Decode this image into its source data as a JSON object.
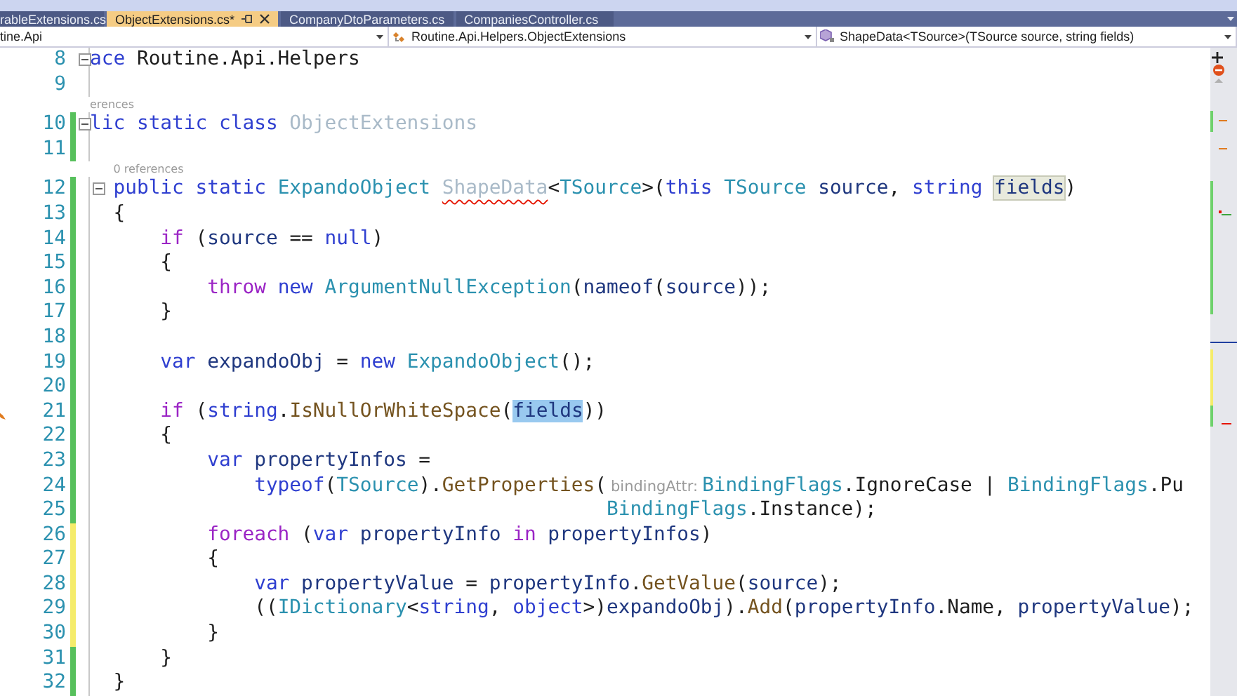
{
  "tabs": [
    {
      "label": "rableExtensions.cs",
      "selected": false
    },
    {
      "label": "ObjectExtensions.cs*",
      "selected": true
    },
    {
      "label": "CompanyDtoParameters.cs",
      "selected": false
    },
    {
      "label": "CompaniesController.cs",
      "selected": false
    }
  ],
  "navigation": [
    {
      "kind": "project",
      "text": "tine.Api"
    },
    {
      "kind": "class",
      "text": "Routine.Api.Helpers.ObjectExtensions"
    },
    {
      "kind": "method",
      "text": "ShapeData<TSource>(TSource source, string fields)"
    }
  ],
  "lines": [
    {
      "number": "8",
      "modified": false,
      "collapsible": true,
      "tokens": [
        {
          "kind": "keyword",
          "text": "ace"
        },
        {
          "kind": "plain",
          "text": " Routine.Api.Helpers"
        }
      ]
    },
    {
      "number": "9",
      "modified": false,
      "collapsible": false
    },
    {
      "codelens": "erences",
      "number": "10",
      "modified": true,
      "saved": true,
      "collapsible": true,
      "tokens": [
        {
          "kind": "keyword",
          "text": "lic static class "
        },
        {
          "kind": "faded",
          "text": "ObjectExtensions"
        }
      ]
    },
    {
      "number": "11",
      "modified": true,
      "saved": true,
      "collapsible": false
    },
    {
      "codelens": "0 references",
      "number": "12",
      "modified": true,
      "saved": true,
      "collapsible": true,
      "tokens": [
        {
          "kind": "keyword",
          "text": "  public static "
        },
        {
          "kind": "type",
          "text": "ExpandoObject "
        },
        {
          "kind": "error",
          "text": "ShapeData"
        },
        {
          "kind": "plain",
          "text": "<"
        },
        {
          "kind": "type",
          "text": "TSource"
        },
        {
          "kind": "plain",
          "text": ">("
        },
        {
          "kind": "keyword",
          "text": "this "
        },
        {
          "kind": "type",
          "text": "TSource "
        },
        {
          "kind": "variable",
          "text": "source"
        },
        {
          "kind": "plain",
          "text": ", "
        },
        {
          "kind": "keyword",
          "text": "string "
        },
        {
          "kind": "reference",
          "text": "fields"
        },
        {
          "kind": "plain",
          "text": ")"
        }
      ]
    },
    {
      "number": "13",
      "modified": true,
      "saved": true,
      "collapsible": false,
      "tokens": [
        {
          "kind": "plain",
          "text": "  {"
        }
      ]
    },
    {
      "number": "14",
      "modified": true,
      "saved": true,
      "collapsible": false,
      "tokens": [
        {
          "kind": "control",
          "text": "      if"
        },
        {
          "kind": "plain",
          "text": " ("
        },
        {
          "kind": "variable",
          "text": "source"
        },
        {
          "kind": "plain",
          "text": " == "
        },
        {
          "kind": "keyword",
          "text": "null"
        },
        {
          "kind": "plain",
          "text": ")"
        }
      ]
    },
    {
      "number": "15",
      "modified": true,
      "saved": true,
      "collapsible": false,
      "tokens": [
        {
          "kind": "plain",
          "text": "      {"
        }
      ]
    },
    {
      "number": "16",
      "modified": true,
      "saved": true,
      "collapsible": false,
      "tokens": [
        {
          "kind": "control",
          "text": "          throw "
        },
        {
          "kind": "keyword",
          "text": "new "
        },
        {
          "kind": "type",
          "text": "ArgumentNullException"
        },
        {
          "kind": "plain",
          "text": "("
        },
        {
          "kind": "variable",
          "text": "nameof"
        },
        {
          "kind": "plain",
          "text": "("
        },
        {
          "kind": "variable",
          "text": "source"
        },
        {
          "kind": "plain",
          "text": "));"
        }
      ]
    },
    {
      "number": "17",
      "modified": true,
      "saved": true,
      "collapsible": false,
      "tokens": [
        {
          "kind": "plain",
          "text": "      }"
        }
      ]
    },
    {
      "number": "18",
      "modified": true,
      "saved": true,
      "collapsible": false
    },
    {
      "number": "19",
      "modified": true,
      "saved": true,
      "collapsible": false,
      "tokens": [
        {
          "kind": "keyword",
          "text": "      var "
        },
        {
          "kind": "variable",
          "text": "expandoObj"
        },
        {
          "kind": "plain",
          "text": " = "
        },
        {
          "kind": "keyword",
          "text": "new "
        },
        {
          "kind": "type",
          "text": "ExpandoObject"
        },
        {
          "kind": "plain",
          "text": "();"
        }
      ]
    },
    {
      "number": "20",
      "modified": true,
      "saved": true,
      "collapsible": false
    },
    {
      "number": "21",
      "modified": true,
      "saved": true,
      "collapsible": false,
      "tokens": [
        {
          "kind": "control",
          "text": "      if"
        },
        {
          "kind": "plain",
          "text": " ("
        },
        {
          "kind": "keyword",
          "text": "string"
        },
        {
          "kind": "plain",
          "text": "."
        },
        {
          "kind": "method",
          "text": "IsNullOrWhiteSpace"
        },
        {
          "kind": "plain",
          "text": "("
        },
        {
          "kind": "selection",
          "text": "fields"
        },
        {
          "kind": "plain",
          "text": "))"
        }
      ]
    },
    {
      "number": "22",
      "modified": true,
      "saved": true,
      "collapsible": false,
      "tokens": [
        {
          "kind": "plain",
          "text": "      {"
        }
      ]
    },
    {
      "number": "23",
      "modified": true,
      "saved": true,
      "collapsible": false,
      "tokens": [
        {
          "kind": "keyword",
          "text": "          var "
        },
        {
          "kind": "variable",
          "text": "propertyInfos"
        },
        {
          "kind": "plain",
          "text": " ="
        }
      ]
    },
    {
      "number": "24",
      "modified": true,
      "saved": true,
      "collapsible": false,
      "tokens": [
        {
          "kind": "keyword",
          "text": "              typeof"
        },
        {
          "kind": "plain",
          "text": "("
        },
        {
          "kind": "type",
          "text": "TSource"
        },
        {
          "kind": "plain",
          "text": ")."
        },
        {
          "kind": "method",
          "text": "GetProperties"
        },
        {
          "kind": "plain",
          "text": "("
        },
        {
          "kind": "hint",
          "text": "bindingAttr:"
        },
        {
          "kind": "type",
          "text": "BindingFlags"
        },
        {
          "kind": "plain",
          "text": ".IgnoreCase | "
        },
        {
          "kind": "type",
          "text": "BindingFlags"
        },
        {
          "kind": "plain",
          "text": ".Pu"
        }
      ]
    },
    {
      "number": "25",
      "modified": true,
      "saved": true,
      "collapsible": false,
      "tokens": [
        {
          "kind": "type",
          "text": "                                            BindingFlags"
        },
        {
          "kind": "plain",
          "text": ".Instance);"
        }
      ]
    },
    {
      "number": "26",
      "modified": true,
      "saved": false,
      "collapsible": false,
      "tokens": [
        {
          "kind": "control",
          "text": "          foreach"
        },
        {
          "kind": "plain",
          "text": " ("
        },
        {
          "kind": "keyword",
          "text": "var "
        },
        {
          "kind": "variable",
          "text": "propertyInfo "
        },
        {
          "kind": "control",
          "text": "in "
        },
        {
          "kind": "variable",
          "text": "propertyInfos"
        },
        {
          "kind": "plain",
          "text": ")"
        }
      ]
    },
    {
      "number": "27",
      "modified": true,
      "saved": false,
      "collapsible": false,
      "tokens": [
        {
          "kind": "plain",
          "text": "          {"
        }
      ]
    },
    {
      "number": "28",
      "modified": true,
      "saved": false,
      "collapsible": false,
      "tokens": [
        {
          "kind": "keyword",
          "text": "              var "
        },
        {
          "kind": "variable",
          "text": "propertyValue"
        },
        {
          "kind": "plain",
          "text": " = "
        },
        {
          "kind": "variable",
          "text": "propertyInfo"
        },
        {
          "kind": "plain",
          "text": "."
        },
        {
          "kind": "method",
          "text": "GetValue"
        },
        {
          "kind": "plain",
          "text": "("
        },
        {
          "kind": "variable",
          "text": "source"
        },
        {
          "kind": "plain",
          "text": ");"
        }
      ]
    },
    {
      "number": "29",
      "modified": true,
      "saved": false,
      "collapsible": false,
      "tokens": [
        {
          "kind": "plain",
          "text": "              (("
        },
        {
          "kind": "type",
          "text": "IDictionary"
        },
        {
          "kind": "plain",
          "text": "<"
        },
        {
          "kind": "keyword",
          "text": "string"
        },
        {
          "kind": "plain",
          "text": ", "
        },
        {
          "kind": "keyword",
          "text": "object"
        },
        {
          "kind": "plain",
          "text": ">)"
        },
        {
          "kind": "variable",
          "text": "expandoObj"
        },
        {
          "kind": "plain",
          "text": ")."
        },
        {
          "kind": "method",
          "text": "Add"
        },
        {
          "kind": "plain",
          "text": "("
        },
        {
          "kind": "variable",
          "text": "propertyInfo"
        },
        {
          "kind": "plain",
          "text": ".Name, "
        },
        {
          "kind": "variable",
          "text": "propertyValue"
        },
        {
          "kind": "plain",
          "text": ");"
        }
      ]
    },
    {
      "number": "30",
      "modified": true,
      "saved": false,
      "collapsible": false,
      "tokens": [
        {
          "kind": "plain",
          "text": "          }"
        }
      ]
    },
    {
      "number": "31",
      "modified": true,
      "saved": true,
      "collapsible": false,
      "tokens": [
        {
          "kind": "plain",
          "text": "      }"
        }
      ]
    },
    {
      "number": "32",
      "modified": true,
      "saved": true,
      "collapsible": false,
      "tokens": [
        {
          "kind": "plain",
          "text": "  }"
        }
      ]
    }
  ]
}
